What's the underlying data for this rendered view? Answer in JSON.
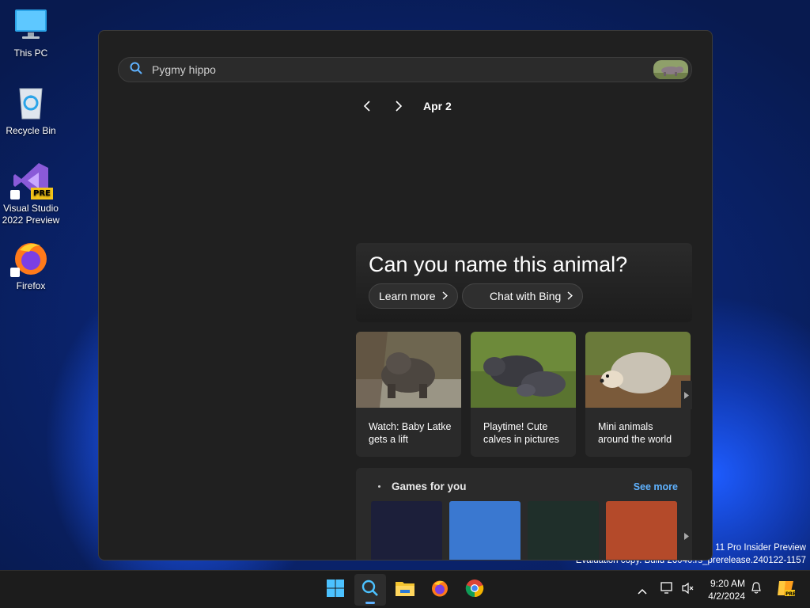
{
  "desktop": {
    "icons": [
      {
        "label": "This PC"
      },
      {
        "label": "Recycle Bin"
      },
      {
        "label": "Visual Studio 2022 Preview",
        "badge": "PRE"
      },
      {
        "label": "Firefox"
      }
    ]
  },
  "watermark": {
    "line1": "s 11 Pro Insider Preview",
    "line2": "Evaluation copy. Build 26040.rs_prerelease.240122-1157"
  },
  "search": {
    "value": "Pygmy hippo",
    "icon": "search-icon"
  },
  "date_nav": {
    "date": "Apr 2"
  },
  "hero": {
    "title": "Can you name this animal?",
    "learn_more": "Learn more",
    "chat_bing": "Chat with Bing"
  },
  "cards": [
    {
      "caption": "Watch: Baby Latke gets a lift"
    },
    {
      "caption": "Playtime! Cute calves in pictures"
    },
    {
      "caption": "Mini animals around the world"
    }
  ],
  "games": {
    "title": "Games for you",
    "see_more": "See more",
    "tile_colors": [
      "#1c1f3a",
      "#3a78d0",
      "#1f2f2a",
      "#b44a2a"
    ]
  },
  "taskbar": {
    "time": "9:20 AM",
    "date": "4/2/2024",
    "accent": "#5fb2ff"
  }
}
